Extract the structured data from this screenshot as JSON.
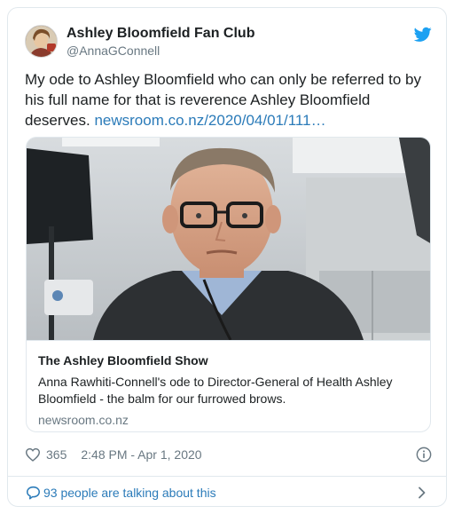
{
  "author": {
    "display_name": "Ashley Bloomfield Fan Club",
    "screen_name": "@AnnaGConnell",
    "avatar_icon": "avatar-photo"
  },
  "tweet": {
    "text": "My ode to Ashley Bloomfield who can only be referred to by his full name for that is reverence Ashley Bloomfield deserves.",
    "link": "newsroom.co.nz/2020/04/01/111…"
  },
  "card": {
    "title": "The Ashley Bloomfield Show",
    "description": "Anna Rawhiti-Connell's ode to Director-General of Health Ashley Bloomfield -  the balm for our furrowed brows.",
    "domain": "newsroom.co.nz"
  },
  "meta": {
    "likes": "365",
    "timestamp": "2:48 PM - Apr 1, 2020"
  },
  "footer": {
    "talking_text": "93 people are talking about this"
  },
  "colors": {
    "link": "#2b7bb9",
    "secondary_text": "#697882",
    "border": "#e1e8ed",
    "twitter_blue": "#1da1f2"
  },
  "icons": [
    "twitter-bird-icon",
    "heart-icon",
    "info-icon",
    "comment-icon",
    "chevron-right-icon"
  ]
}
